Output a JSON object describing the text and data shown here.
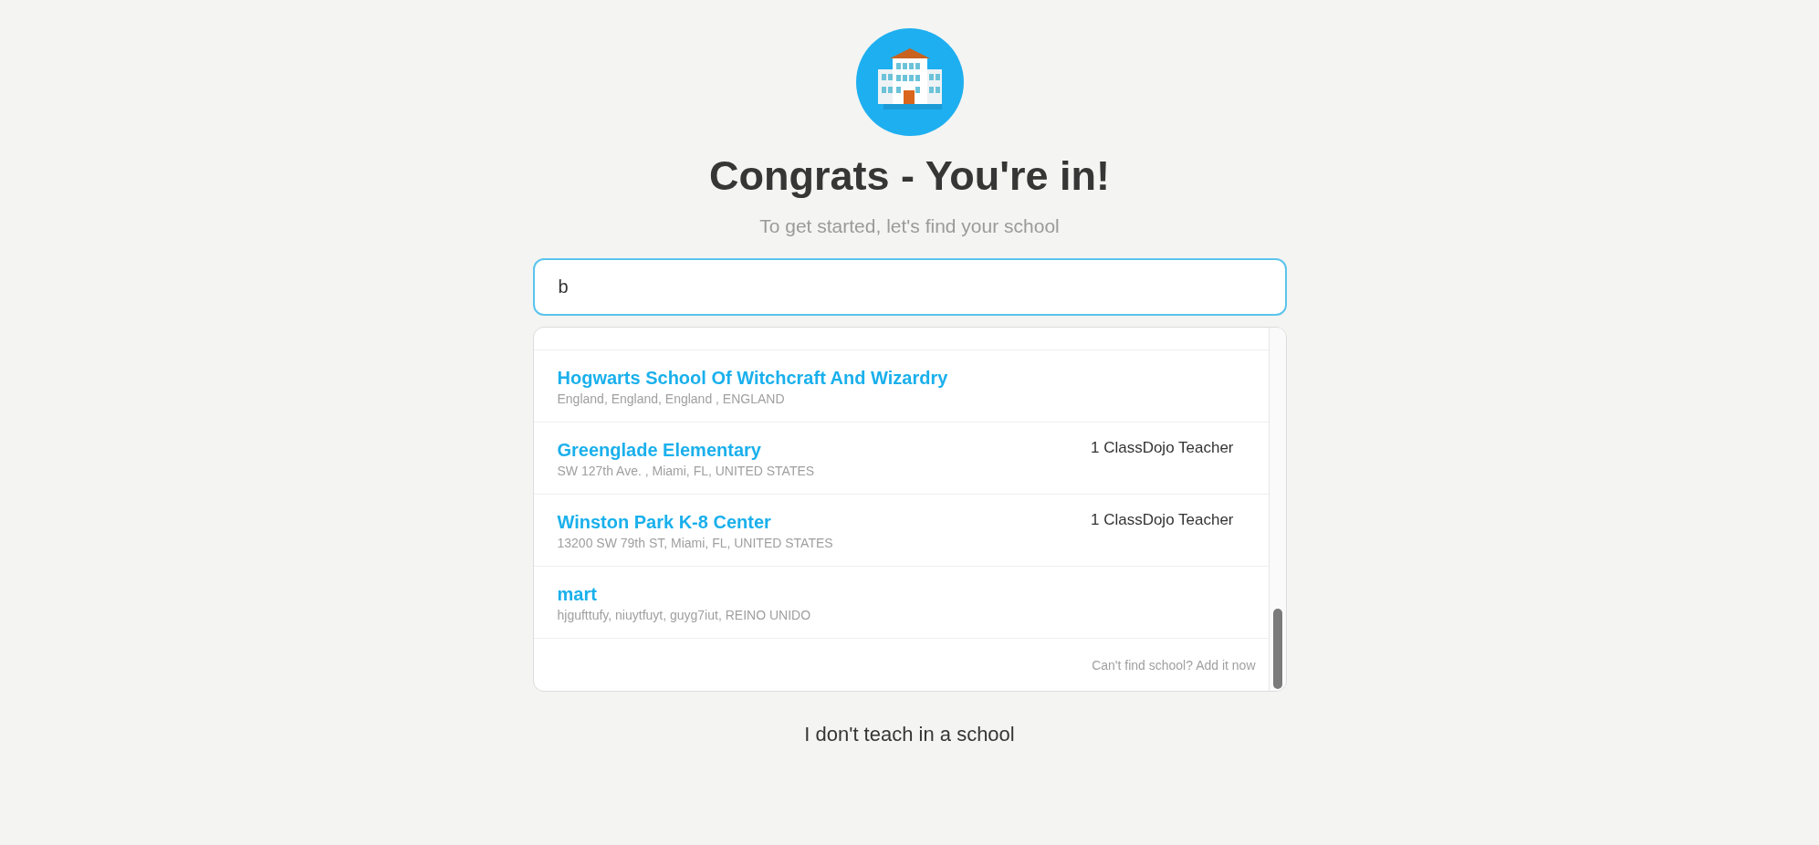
{
  "title": "Congrats - You're in!",
  "subtitle": "To get started, let's find your school",
  "search": {
    "value": "b"
  },
  "results": [
    {
      "name": "Hogwarts School Of Witchcraft And Wizardry",
      "address": "England, England, England , ENGLAND"
    },
    {
      "name": "Greenglade Elementary",
      "address": "SW 127th Ave. , Miami, FL, UNITED STATES",
      "teachers": "1 ClassDojo Teacher"
    },
    {
      "name": "Winston Park K-8 Center",
      "address": "13200 SW 79th ST, Miami, FL, UNITED STATES",
      "teachers": "1 ClassDojo Teacher"
    },
    {
      "name": "mart",
      "address": "hjgufttufy, niuytfuyt, guyg7iut, REINO UNIDO"
    }
  ],
  "add_link": "Can't find school? Add it now",
  "no_school_link": "I don't teach in a school"
}
